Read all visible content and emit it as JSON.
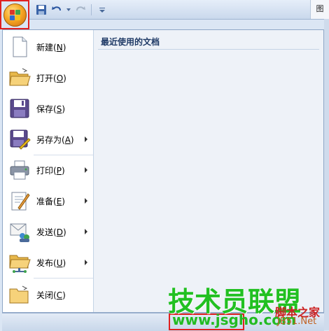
{
  "quick_access": {
    "save_icon": "save-icon",
    "undo_icon": "undo-icon",
    "redo_icon": "redo-icon",
    "customize_icon": "customize-icon"
  },
  "title_fragment": "图",
  "recent": {
    "title": "最近使用的文档"
  },
  "menu": [
    {
      "label": "新建",
      "key": "N",
      "icon": "new-document-icon",
      "has_submenu": false
    },
    {
      "label": "打开",
      "key": "O",
      "icon": "open-folder-icon",
      "has_submenu": false
    },
    {
      "label": "保存",
      "key": "S",
      "icon": "save-disk-icon",
      "has_submenu": false
    },
    {
      "label": "另存为",
      "key": "A",
      "icon": "save-as-icon",
      "has_submenu": true
    },
    {
      "label": "打印",
      "key": "P",
      "icon": "printer-icon",
      "has_submenu": true
    },
    {
      "label": "准备",
      "key": "E",
      "icon": "prepare-icon",
      "has_submenu": true
    },
    {
      "label": "发送",
      "key": "D",
      "icon": "send-icon",
      "has_submenu": true
    },
    {
      "label": "发布",
      "key": "U",
      "icon": "publish-icon",
      "has_submenu": true
    },
    {
      "label": "关闭",
      "key": "C",
      "icon": "close-folder-icon",
      "has_submenu": false
    }
  ],
  "watermark": {
    "title": "技术员联盟",
    "url": "www.jsgho.com",
    "small_text1": "脚本之家",
    "small_text2": "JB51.Net"
  },
  "colors": {
    "highlight_border": "#e02020",
    "watermark_green": "#21c021",
    "accent_blue": "#1f3a66"
  }
}
